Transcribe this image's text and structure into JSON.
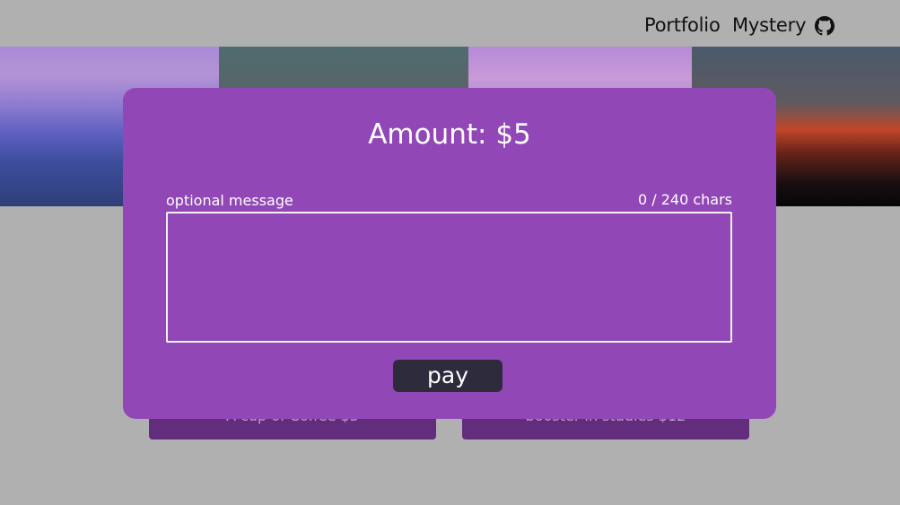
{
  "nav": {
    "links": [
      {
        "label": "Portfolio"
      },
      {
        "label": "Mystery"
      }
    ],
    "github_icon": "github-icon"
  },
  "background_buttons": [
    {
      "label": "A cup of Coffee $5"
    },
    {
      "label": "booster in studies $12"
    }
  ],
  "modal": {
    "amount_label": "Amount: $5",
    "message_label": "optional message",
    "char_count": "0 / 240 chars",
    "message_value": "",
    "pay_label": "pay",
    "background_color": "#9247b7"
  },
  "colors": {
    "page_background": "#b0b0b0",
    "pay_button": "#2e2b3d",
    "underlying_button": "#632d7d"
  }
}
